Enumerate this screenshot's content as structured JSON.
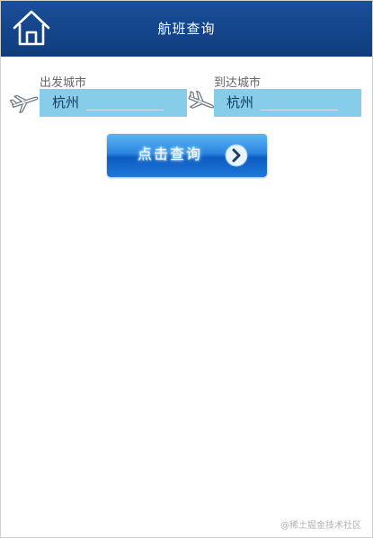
{
  "header": {
    "title": "航班查询",
    "home_icon": "home-icon"
  },
  "departure": {
    "label": "出发城市",
    "value": "杭州",
    "icon": "airplane-takeoff-icon"
  },
  "arrival": {
    "label": "到达城市",
    "value": "杭州",
    "icon": "airplane-landing-icon"
  },
  "search_button": {
    "label": "点击查询",
    "icon": "chevron-right-circle-icon"
  },
  "watermark": "@稀土掘金技术社区",
  "colors": {
    "header": "#0f3c7e",
    "field": "#87cdea",
    "button": "#1f76d8"
  }
}
